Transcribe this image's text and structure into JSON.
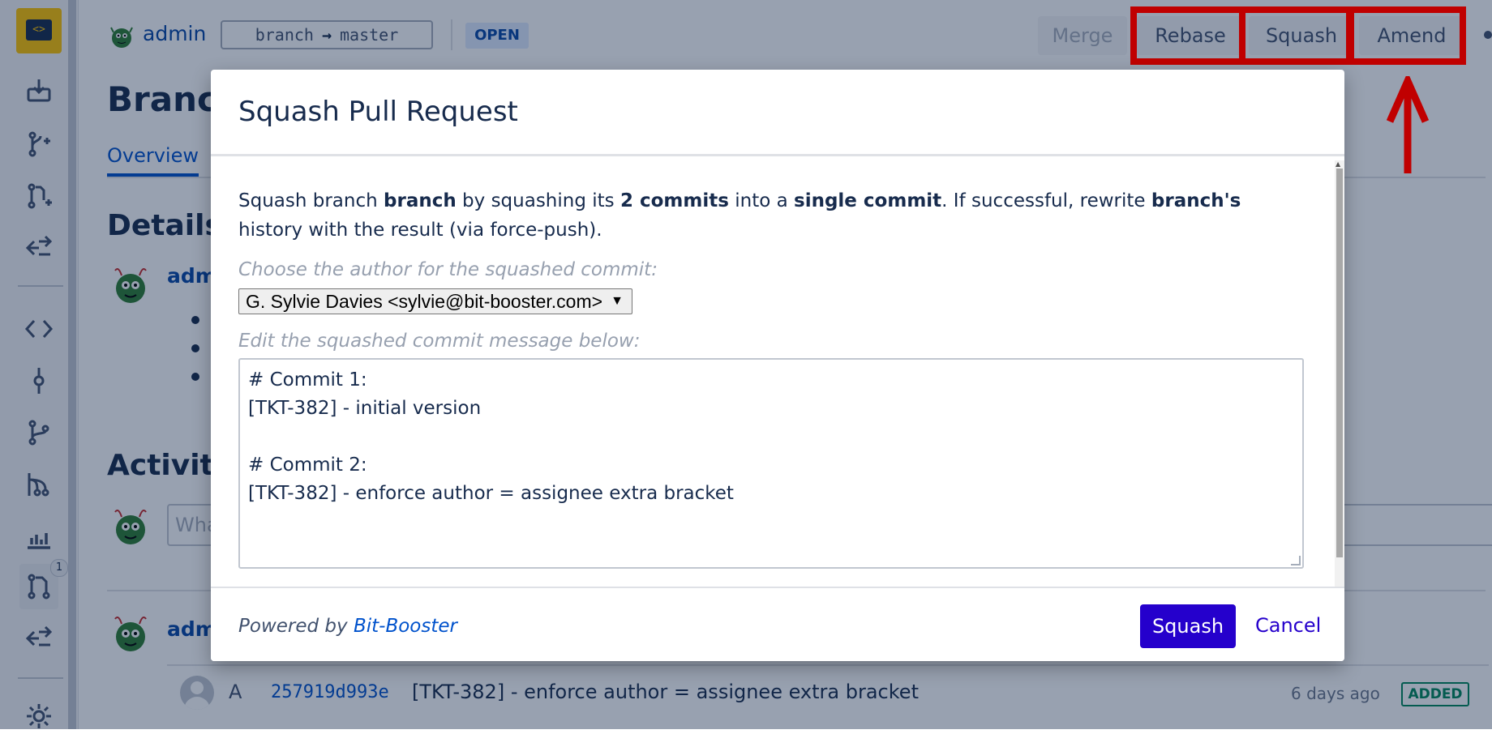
{
  "sidebar": {
    "badge_count": "1",
    "icons": [
      "clone-icon",
      "branch-create-icon",
      "pull-request-create-icon",
      "compare-icon",
      "source-icon",
      "commit-icon",
      "branches-icon",
      "network-icon",
      "stats-icon",
      "pull-requests-icon",
      "compare-icon",
      "settings-icon"
    ]
  },
  "header": {
    "user": "admin",
    "source_branch": "branch",
    "target_branch": "master",
    "status": "OPEN",
    "buttons": {
      "merge": "Merge",
      "rebase": "Rebase",
      "squash": "Squash",
      "amend": "Amend"
    }
  },
  "page": {
    "title_partial": "Branch",
    "tab_overview": "Overview",
    "details_title": "Details",
    "details_user": "admi",
    "activity_title": "Activity",
    "comment_placeholder": "Wha",
    "activity_user": "admi"
  },
  "commit": {
    "author_initial": "A",
    "hash": "257919d993e",
    "message": "[TKT-382] - enforce author = assignee extra bracket",
    "time": "6 days ago",
    "status": "ADDED"
  },
  "modal": {
    "title": "Squash Pull Request",
    "desc": {
      "p1": "Squash branch ",
      "b1": "branch",
      "p2": " by squashing its ",
      "b2": "2 commits",
      "p3": " into a ",
      "b3": "single commit",
      "p4": ". If successful, rewrite ",
      "b4": "branch's",
      "p5": " history with the result (via force-push)."
    },
    "author_label": "Choose the author for the squashed commit:",
    "author_selected": "G. Sylvie Davies <sylvie@bit-booster.com>",
    "message_label": "Edit the squashed commit message below:",
    "message_lines": [
      "# Commit 1:",
      "[TKT-382] - initial version",
      "",
      "# Commit 2:",
      "[TKT-382] - enforce author = assignee extra bracket"
    ],
    "powered_prefix": "Powered by ",
    "powered_link": "Bit-Booster",
    "squash_button": "Squash",
    "cancel_button": "Cancel"
  },
  "colors": {
    "accent": "#2500cc",
    "highlight": "#c00000",
    "link": "#0052cc",
    "logo": "#ffc400"
  }
}
